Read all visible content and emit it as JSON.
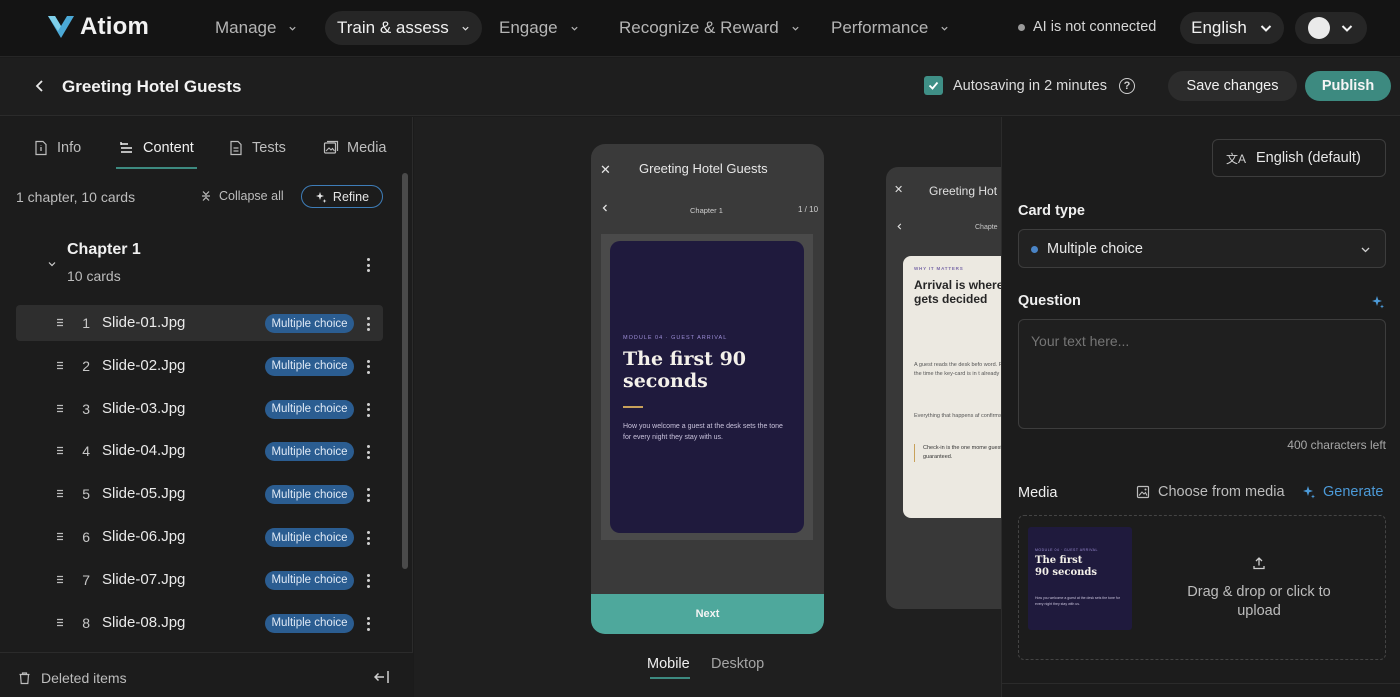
{
  "app": {
    "name": "Atiom"
  },
  "nav": {
    "items": [
      {
        "label": "Manage"
      },
      {
        "label": "Train & assess"
      },
      {
        "label": "Engage"
      },
      {
        "label": "Recognize & Reward"
      },
      {
        "label": "Performance"
      }
    ],
    "ai_status": "AI is not connected",
    "language": "English"
  },
  "header": {
    "course_title": "Greeting Hotel Guests",
    "autosave": "Autosaving in 2 minutes",
    "save_label": "Save changes",
    "publish_label": "Publish"
  },
  "left_panel": {
    "tabs": [
      {
        "label": "Info"
      },
      {
        "label": "Content"
      },
      {
        "label": "Tests"
      },
      {
        "label": "Media"
      }
    ],
    "summary": "1 chapter, 10 cards",
    "collapse_label": "Collapse all",
    "refine_label": "Refine",
    "chapter": {
      "title": "Chapter 1",
      "subtitle": "10 cards"
    },
    "slides": [
      {
        "num": "1",
        "name": "Slide-01.Jpg",
        "badge": "Multiple choice"
      },
      {
        "num": "2",
        "name": "Slide-02.Jpg",
        "badge": "Multiple choice"
      },
      {
        "num": "3",
        "name": "Slide-03.Jpg",
        "badge": "Multiple choice"
      },
      {
        "num": "4",
        "name": "Slide-04.Jpg",
        "badge": "Multiple choice"
      },
      {
        "num": "5",
        "name": "Slide-05.Jpg",
        "badge": "Multiple choice"
      },
      {
        "num": "6",
        "name": "Slide-06.Jpg",
        "badge": "Multiple choice"
      },
      {
        "num": "7",
        "name": "Slide-07.Jpg",
        "badge": "Multiple choice"
      },
      {
        "num": "8",
        "name": "Slide-08.Jpg",
        "badge": "Multiple choice"
      }
    ],
    "deleted_label": "Deleted items"
  },
  "preview": {
    "mobile": {
      "title": "Greeting Hotel Guests",
      "chapter": "Chapter 1",
      "page": "1 / 10",
      "slide_kicker": "MODULE 04 · GUEST ARRIVAL",
      "slide_heading": "The first 90 seconds",
      "slide_body": "How you welcome a guest at the desk sets the tone for every night they stay with us.",
      "next_label": "Next"
    },
    "desktop": {
      "title": "Greeting Hot",
      "chapter": "Chapte",
      "kicker": "WHY IT MATTERS",
      "heading": "Arrival is where\ngets decided",
      "body1": "A guest reads the desk befo word. Posture, pace, whethe the time the key-card is in t already decided what kind",
      "body2": "Everything that happens af confirms that read or works",
      "quote": "Check-in is the one mome guest goes through. No d guaranteed."
    },
    "view_tabs": {
      "mobile": "Mobile",
      "desktop": "Desktop"
    }
  },
  "right_panel": {
    "language": "English (default)",
    "card_type_label": "Card type",
    "card_type_value": "Multiple choice",
    "question_label": "Question",
    "question_placeholder": "Your text here...",
    "char_counter": "400 characters left",
    "media_label": "Media",
    "choose_media": "Choose from media",
    "generate": "Generate",
    "thumb_kicker": "MODULE 04 · GUEST ARRIVAL",
    "thumb_heading": "The first\n90 seconds",
    "thumb_body": "How you welcome a guest at the desk sets the tone for every night they stay with us.",
    "upload_text": "Drag & drop or click to upload"
  },
  "colors": {
    "accent": "#3d8a80",
    "badge": "#2b5d91",
    "generate": "#4c9ad8"
  }
}
